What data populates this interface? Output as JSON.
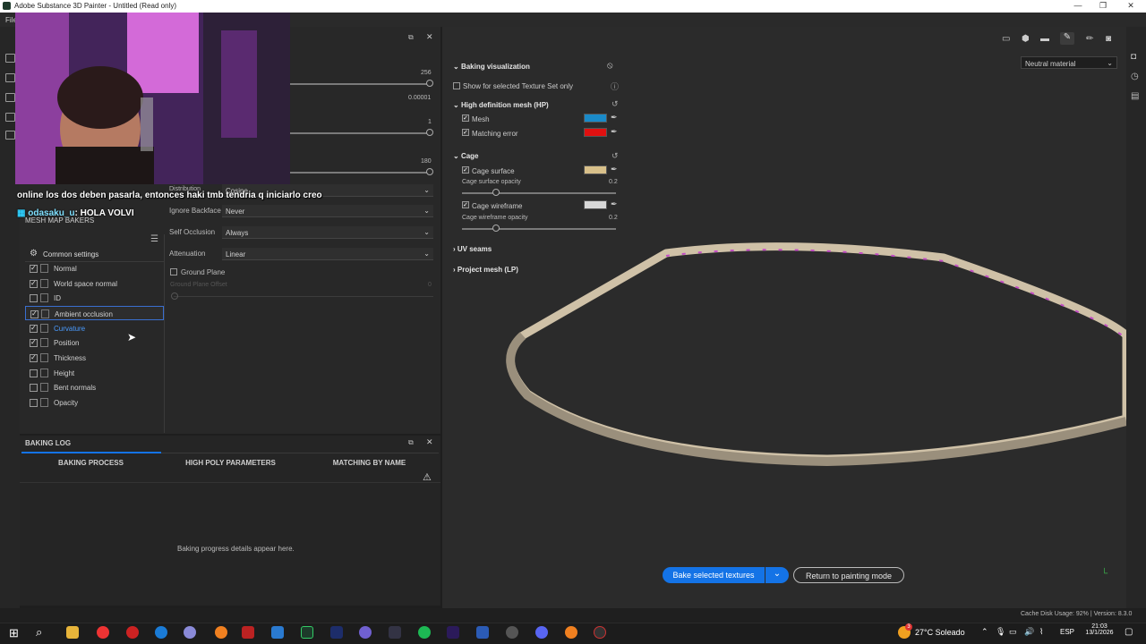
{
  "window": {
    "title": "Adobe Substance 3D Painter - Untitled (Read only)",
    "menu_first": "File"
  },
  "stream": {
    "chat_line1": "online los dos deben pasarla, entonces haki tmb tendria q iniciarlo creo",
    "chat_user": "odasaku_u",
    "chat_message": ": HOLA VOLVI"
  },
  "baker": {
    "panel_title": "MESH MAP BAKERS",
    "common_settings": "Common settings",
    "items": [
      {
        "label": "Normal",
        "checked": true
      },
      {
        "label": "World space normal",
        "checked": true
      },
      {
        "label": "ID",
        "checked": false
      },
      {
        "label": "Ambient occlusion",
        "checked": true
      },
      {
        "label": "Curvature",
        "checked": true
      },
      {
        "label": "Position",
        "checked": true
      },
      {
        "label": "Thickness",
        "checked": true
      },
      {
        "label": "Height",
        "checked": false
      },
      {
        "label": "Bent normals",
        "checked": false
      },
      {
        "label": "Opacity",
        "checked": false
      }
    ],
    "values": {
      "v1": "256",
      "v2": "0.00001",
      "v3": "1",
      "v4": "180",
      "zero": "0"
    },
    "distribution_label": "Distribution",
    "distribution_value": "Cosine",
    "ignore_backface_label": "Ignore Backface",
    "ignore_backface_value": "Never",
    "self_occlusion_label": "Self Occlusion",
    "self_occlusion_value": "Always",
    "attenuation_label": "Attenuation",
    "attenuation_value": "Linear",
    "ground_plane": "Ground Plane",
    "ground_plane_offset": "Ground Plane Offset"
  },
  "baking_viz": {
    "title": "Baking visualization",
    "show_selected": "Show for selected Texture Set only",
    "hp_title": "High definition mesh (HP)",
    "mesh": "Mesh",
    "matching_error": "Matching error",
    "cage_title": "Cage",
    "cage_surface": "Cage surface",
    "cage_surface_opacity": "Cage surface opacity",
    "cage_surface_opacity_val": "0.2",
    "cage_wireframe": "Cage wireframe",
    "cage_wireframe_opacity": "Cage wireframe opacity",
    "cage_wireframe_opacity_val": "0.2",
    "uv_seams": "UV seams",
    "project_mesh": "Project mesh (LP)",
    "colors": {
      "mesh": "#1a8ac8",
      "matching_error": "#e01010",
      "cage_surface": "#d8c08a",
      "cage_wireframe": "#d8d8d8"
    }
  },
  "viewport": {
    "material_dropdown": "Neutral material",
    "bake_button": "Bake selected textures",
    "return_button": "Return to painting mode"
  },
  "log": {
    "title": "BAKING LOG",
    "tabs": [
      "BAKING PROCESS",
      "HIGH POLY PARAMETERS",
      "MATCHING BY NAME"
    ],
    "placeholder": "Baking progress details appear here."
  },
  "status": {
    "cache": "Cache Disk Usage:",
    "cache_val": "92%",
    "version": "| Version: 8.3.0"
  },
  "taskbar": {
    "weather": "27°C Soleado",
    "lang": "ESP",
    "time": "21:03",
    "date": "13/1/2026",
    "badge": "3"
  }
}
